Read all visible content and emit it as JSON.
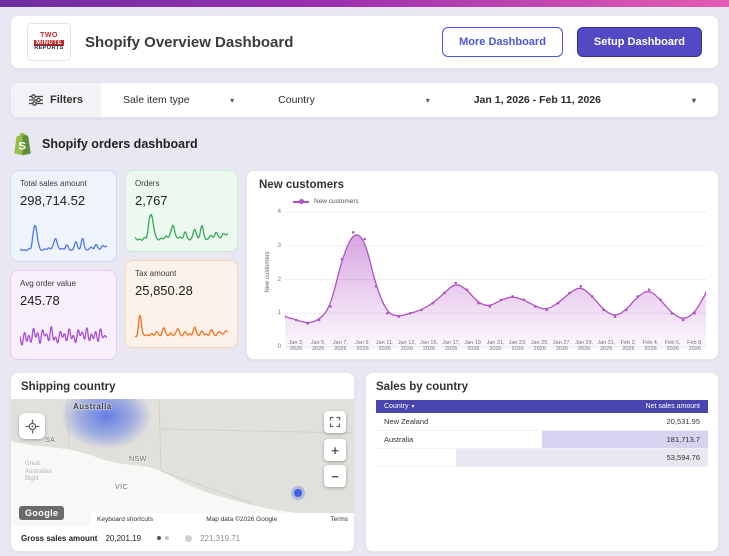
{
  "header": {
    "logo": {
      "line1": "TWO",
      "line2": "MINUTE",
      "line3": "REPORTS"
    },
    "title": "Shopify Overview Dashboard",
    "buttons": {
      "more": "More Dashboard",
      "setup": "Setup Dashboard"
    }
  },
  "filter_bar": {
    "filters_label": "Filters",
    "caret": "▾",
    "dropdowns": [
      {
        "label": "Sale item type"
      },
      {
        "label": "Country"
      },
      {
        "label": "Jan 1, 2026 - Feb 11, 2026"
      }
    ]
  },
  "section": {
    "title": "Shopify orders dashboard"
  },
  "kpis": [
    {
      "label": "Total sales amount",
      "value": "298,714.52",
      "accent": "#4e79e6"
    },
    {
      "label": "Orders",
      "value": "2,767",
      "accent": "#34a853"
    },
    {
      "label": "Avg order value",
      "value": "245.78",
      "accent": "#a64dd6"
    },
    {
      "label": "Tax amount",
      "value": "25,850.28",
      "accent": "#f0731e"
    }
  ],
  "chart_data": [
    {
      "id": "spark-total-sales",
      "type": "line",
      "title": "Total sales amount sparkline",
      "color": "#4e79e6",
      "values": [
        32,
        28,
        30,
        27,
        34,
        30,
        78,
        95,
        52,
        30,
        28,
        33,
        30,
        36,
        30,
        44,
        62,
        38,
        30,
        34,
        30,
        46,
        30,
        28,
        32,
        55,
        34,
        30,
        66,
        34,
        28,
        32,
        38,
        30,
        46,
        34,
        30,
        42,
        36,
        40
      ]
    },
    {
      "id": "spark-orders",
      "type": "line",
      "title": "Orders sparkline",
      "color": "#34a853",
      "values": [
        40,
        34,
        38,
        33,
        42,
        36,
        82,
        90,
        55,
        38,
        34,
        40,
        36,
        45,
        38,
        52,
        70,
        44,
        38,
        42,
        36,
        56,
        38,
        34,
        40,
        62,
        42,
        38,
        72,
        42,
        34,
        40,
        46,
        38,
        54,
        42,
        38,
        50,
        44,
        48
      ]
    },
    {
      "id": "spark-avg-order-value",
      "type": "line",
      "title": "Avg order value sparkline",
      "color": "#a64dd6",
      "values": [
        50,
        35,
        60,
        40,
        55,
        38,
        65,
        45,
        58,
        36,
        62,
        48,
        55,
        40,
        68,
        42,
        52,
        38,
        60,
        46,
        56,
        40,
        64,
        44,
        54,
        38,
        62,
        48,
        58,
        42,
        66,
        40,
        56,
        44,
        60,
        38,
        64,
        46,
        52,
        48
      ]
    },
    {
      "id": "spark-tax-amount",
      "type": "line",
      "title": "Tax amount sparkline",
      "color": "#f0731e",
      "values": [
        30,
        28,
        95,
        40,
        30,
        34,
        30,
        38,
        30,
        44,
        32,
        30,
        56,
        34,
        30,
        40,
        30,
        36,
        52,
        32,
        30,
        44,
        30,
        38,
        30,
        58,
        34,
        30,
        46,
        32,
        36,
        30,
        50,
        34,
        30,
        42,
        38,
        34,
        44,
        40
      ]
    },
    {
      "id": "new-customers",
      "type": "area",
      "title": "New customers",
      "legend": [
        "New customers"
      ],
      "legend_position": "top-left",
      "color": "#b14fc4",
      "markers": true,
      "grid": true,
      "ylabel": "New customers",
      "ylim": [
        0,
        4
      ],
      "yticks": [
        0,
        1,
        2,
        3,
        4
      ],
      "x_labels": [
        "Jan 3, 2026",
        "Jan 5, 2026",
        "Jan 7, 2026",
        "Jan 9, 2026",
        "Jan 11, 2026",
        "Jan 13, 2026",
        "Jan 15, 2026",
        "Jan 17, 2026",
        "Jan 19, 2026",
        "Jan 21, 2026",
        "Jan 23, 2026",
        "Jan 25, 2026",
        "Jan 27, 2026",
        "Jan 29, 2026",
        "Jan 31, 2026",
        "Feb 2, 2026",
        "Feb 4, 2026",
        "Feb 6, 2026",
        "Feb 8, 2026"
      ],
      "values": [
        0.9,
        0.8,
        0.7,
        0.8,
        1.2,
        2.6,
        3.4,
        3.2,
        1.8,
        1.0,
        0.9,
        1.0,
        1.1,
        1.3,
        1.6,
        1.9,
        1.7,
        1.3,
        1.2,
        1.4,
        1.5,
        1.4,
        1.2,
        1.1,
        1.3,
        1.6,
        1.8,
        1.5,
        1.1,
        0.9,
        1.1,
        1.5,
        1.7,
        1.4,
        1.0,
        0.8,
        1.0,
        1.6
      ]
    }
  ],
  "shipping": {
    "title": "Shipping country",
    "map_labels": {
      "country": "Australia",
      "sa": "SA",
      "nsw": "NSW",
      "vic": "VIC",
      "water": "Great\nAustralian\nBight"
    },
    "controls": {
      "zoom_in": "+",
      "zoom_out": "−"
    },
    "attribution": {
      "google": "Google",
      "shortcuts": "Keyboard shortcuts",
      "map_data": "Map data ©2026 Google",
      "terms": "Terms"
    }
  },
  "gross": {
    "label": "Gross sales amount",
    "value1": "20,201.19",
    "value2": "221,319.71"
  },
  "sales_table": {
    "title": "Sales by country",
    "header_bg": "#4945ae",
    "columns": {
      "country": "Country",
      "value": "Net sales amount"
    },
    "caret": "▾",
    "rows": [
      {
        "country": "New Zealand",
        "value": "20,531.95",
        "bar": 0,
        "bar_color": "#ddd8f2"
      },
      {
        "country": "Australia",
        "value": "181,713.7",
        "bar": 0.5,
        "bar_color": "#d7d2ef"
      },
      {
        "country": "",
        "value": "53,594.76",
        "bar": 0.76,
        "bar_color": "#e9e8f0"
      }
    ]
  }
}
